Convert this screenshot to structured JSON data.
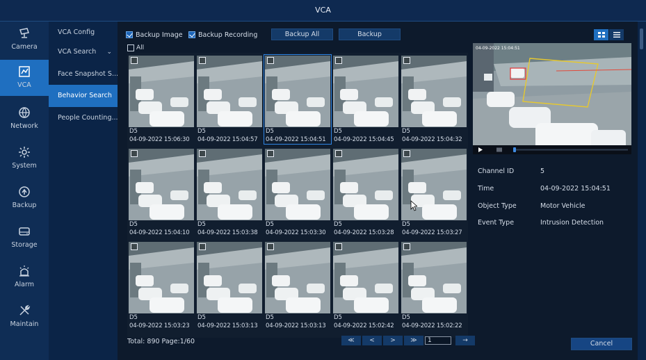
{
  "window": {
    "title": "VCA"
  },
  "nav": [
    {
      "label": "Camera",
      "icon": "camera-icon",
      "active": false
    },
    {
      "label": "VCA",
      "icon": "vca-icon",
      "active": true
    },
    {
      "label": "Network",
      "icon": "network-icon",
      "active": false
    },
    {
      "label": "System",
      "icon": "gear-icon",
      "active": false
    },
    {
      "label": "Backup",
      "icon": "backup-icon",
      "active": false
    },
    {
      "label": "Storage",
      "icon": "storage-icon",
      "active": false
    },
    {
      "label": "Alarm",
      "icon": "alarm-icon",
      "active": false
    },
    {
      "label": "Maintain",
      "icon": "wrench-icon",
      "active": false
    }
  ],
  "subnav": [
    {
      "label": "VCA Config",
      "active": false
    },
    {
      "label": "VCA Search",
      "active": false,
      "expandable": true,
      "chevron": "⌄"
    },
    {
      "label": "Face Snapshot S...",
      "active": false
    },
    {
      "label": "Behavior Search",
      "active": true
    },
    {
      "label": "People Counting...",
      "active": false
    }
  ],
  "toolbar": {
    "backup_image": {
      "label": "Backup Image",
      "checked": true
    },
    "backup_recording": {
      "label": "Backup Recording",
      "checked": true
    },
    "backup_all_label": "Backup All",
    "backup_label": "Backup"
  },
  "view_toggle": {
    "grid_icon": "grid-view-icon",
    "list_icon": "list-view-icon",
    "active": "grid"
  },
  "select_all": {
    "label": "All",
    "checked": false
  },
  "results": [
    {
      "channel": "D5",
      "time": "04-09-2022 15:06:30",
      "selected": false
    },
    {
      "channel": "D5",
      "time": "04-09-2022 15:04:57",
      "selected": false
    },
    {
      "channel": "D5",
      "time": "04-09-2022 15:04:51",
      "selected": true
    },
    {
      "channel": "D5",
      "time": "04-09-2022 15:04:45",
      "selected": false
    },
    {
      "channel": "D5",
      "time": "04-09-2022 15:04:32",
      "selected": false
    },
    {
      "channel": "D5",
      "time": "04-09-2022 15:04:10",
      "selected": false
    },
    {
      "channel": "D5",
      "time": "04-09-2022 15:03:38",
      "selected": false
    },
    {
      "channel": "D5",
      "time": "04-09-2022 15:03:30",
      "selected": false
    },
    {
      "channel": "D5",
      "time": "04-09-2022 15:03:28",
      "selected": false
    },
    {
      "channel": "D5",
      "time": "04-09-2022 15:03:27",
      "selected": false
    },
    {
      "channel": "D5",
      "time": "04-09-2022 15:03:23",
      "selected": false
    },
    {
      "channel": "D5",
      "time": "04-09-2022 15:03:13",
      "selected": false
    },
    {
      "channel": "D5",
      "time": "04-09-2022 15:03:13",
      "selected": false
    },
    {
      "channel": "D5",
      "time": "04-09-2022 15:02:42",
      "selected": false
    },
    {
      "channel": "D5",
      "time": "04-09-2022 15:02:22",
      "selected": false
    }
  ],
  "footer": {
    "total_text": "Total: 890  Page:1/60",
    "pager": {
      "first": "≪",
      "prev": "<",
      "next": ">",
      "last": "≫",
      "page_value": "1",
      "go": "→"
    }
  },
  "preview": {
    "overlay_text": "04-09-2022 15:04:51"
  },
  "details": [
    {
      "label": "Channel ID",
      "value": "5"
    },
    {
      "label": "Time",
      "value": "04-09-2022 15:04:51"
    },
    {
      "label": "Object Type",
      "value": "Motor Vehicle"
    },
    {
      "label": "Event Type",
      "value": "Intrusion Detection"
    }
  ],
  "cancel_label": "Cancel",
  "colors": {
    "accent": "#1f6fc0",
    "title_bar": "#0e2950",
    "background": "#0d1a2c",
    "selection": "#2f86e6",
    "intrusion_box": "#e6c830"
  }
}
